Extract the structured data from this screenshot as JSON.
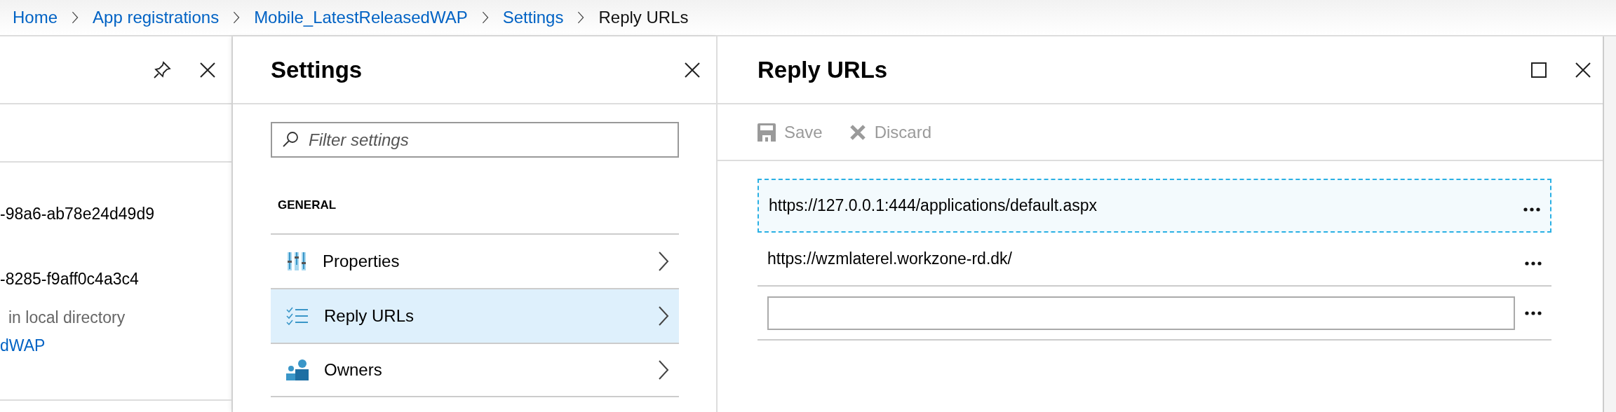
{
  "breadcrumb": [
    {
      "label": "Home",
      "current": false
    },
    {
      "label": "App registrations",
      "current": false
    },
    {
      "label": "Mobile_LatestReleasedWAP",
      "current": false
    },
    {
      "label": "Settings",
      "current": false
    },
    {
      "label": "Reply URLs",
      "current": true
    }
  ],
  "left_blade": {
    "lines": [
      {
        "text": "-98a6-ab78e24d49d9",
        "kind": "text"
      },
      {
        "text": "-8285-f9aff0c4a3c4",
        "kind": "text"
      },
      {
        "text": "in local directory",
        "kind": "note"
      },
      {
        "text": "dWAP",
        "kind": "link"
      }
    ]
  },
  "settings": {
    "title": "Settings",
    "filter": {
      "placeholder": "Filter settings"
    },
    "section": "GENERAL",
    "items": [
      {
        "label": "Properties",
        "kind": "properties",
        "selected": false
      },
      {
        "label": "Reply URLs",
        "kind": "list",
        "selected": true
      },
      {
        "label": "Owners",
        "kind": "owners",
        "selected": false
      }
    ]
  },
  "reply_urls": {
    "title": "Reply URLs",
    "toolbar": [
      {
        "label": "Save",
        "kind": "save",
        "disabled": true
      },
      {
        "label": "Discard",
        "kind": "discard",
        "disabled": true
      }
    ],
    "urls": [
      {
        "kind": "text",
        "value": "https://127.0.0.1:444/applications/default.aspx",
        "focused": true
      },
      {
        "kind": "text",
        "value": "https://wzmlaterel.workzone-rd.dk/",
        "focused": false
      },
      {
        "kind": "input",
        "focused": false
      }
    ]
  }
}
